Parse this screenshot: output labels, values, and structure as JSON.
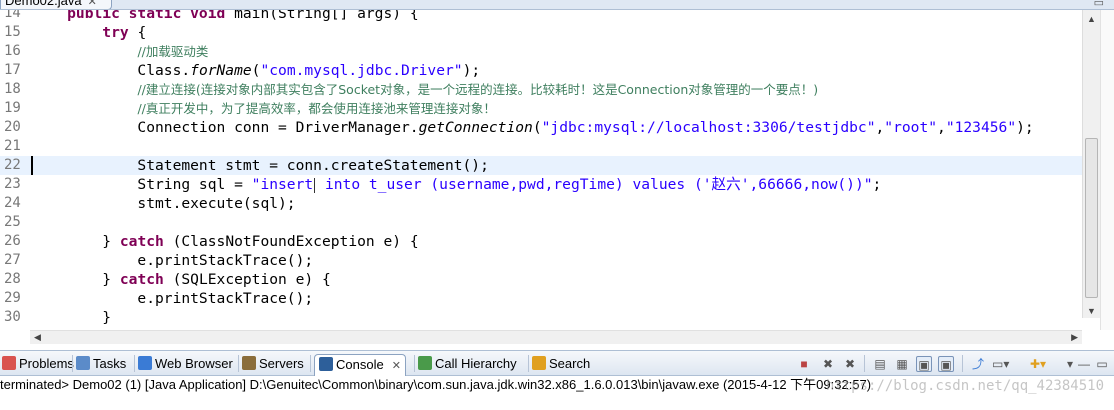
{
  "editor_tab": {
    "title": "Demo02.java",
    "close": "✕"
  },
  "code_lines": [
    {
      "num": "14",
      "segments": [
        {
          "t": "    public static void ",
          "c": "kw"
        },
        {
          "t": "main(String[] args) {",
          "c": ""
        }
      ]
    },
    {
      "num": "15",
      "segments": [
        {
          "t": "        ",
          "c": ""
        },
        {
          "t": "try",
          "c": "kw"
        },
        {
          "t": " {",
          "c": ""
        }
      ]
    },
    {
      "num": "16",
      "segments": [
        {
          "t": "            ",
          "c": ""
        },
        {
          "t": "//加载驱动类",
          "c": "cm"
        }
      ]
    },
    {
      "num": "17",
      "segments": [
        {
          "t": "            Class.",
          "c": ""
        },
        {
          "t": "forName",
          "c": "it"
        },
        {
          "t": "(",
          "c": ""
        },
        {
          "t": "\"com.mysql.jdbc.Driver\"",
          "c": "str"
        },
        {
          "t": ");",
          "c": ""
        }
      ]
    },
    {
      "num": "18",
      "segments": [
        {
          "t": "            ",
          "c": ""
        },
        {
          "t": "//建立连接(连接对象内部其实包含了Socket对象，是一个远程的连接。比较耗时！这是Connection对象管理的一个要点！)",
          "c": "cm"
        }
      ]
    },
    {
      "num": "19",
      "segments": [
        {
          "t": "            ",
          "c": ""
        },
        {
          "t": "//真正开发中，为了提高效率，都会使用连接池来管理连接对象！",
          "c": "cm"
        }
      ]
    },
    {
      "num": "20",
      "segments": [
        {
          "t": "            Connection conn = DriverManager.",
          "c": ""
        },
        {
          "t": "getConnection",
          "c": "it"
        },
        {
          "t": "(",
          "c": ""
        },
        {
          "t": "\"jdbc:mysql://localhost:3306/testjdbc\"",
          "c": "str"
        },
        {
          "t": ",",
          "c": ""
        },
        {
          "t": "\"root\"",
          "c": "str"
        },
        {
          "t": ",",
          "c": ""
        },
        {
          "t": "\"123456\"",
          "c": "str"
        },
        {
          "t": ");",
          "c": ""
        }
      ]
    },
    {
      "num": "21",
      "segments": []
    },
    {
      "num": "22",
      "segments": [
        {
          "t": "            Statement stmt = conn.createStatement();",
          "c": ""
        }
      ]
    },
    {
      "num": "23",
      "segments": [
        {
          "t": "            String sql = ",
          "c": ""
        },
        {
          "t": "\"insert",
          "c": "str"
        },
        {
          "t": "",
          "c": "cursor"
        },
        {
          "t": " into t_user (username,pwd,regTime) values ('赵六',66666,now())\"",
          "c": "str"
        },
        {
          "t": ";",
          "c": ""
        }
      ]
    },
    {
      "num": "24",
      "segments": [
        {
          "t": "            stmt.execute(sql);",
          "c": ""
        }
      ]
    },
    {
      "num": "25",
      "segments": []
    },
    {
      "num": "26",
      "segments": [
        {
          "t": "        } ",
          "c": ""
        },
        {
          "t": "catch",
          "c": "kw"
        },
        {
          "t": " (ClassNotFoundException e) {",
          "c": ""
        }
      ]
    },
    {
      "num": "27",
      "segments": [
        {
          "t": "            e.printStackTrace();",
          "c": ""
        }
      ]
    },
    {
      "num": "28",
      "segments": [
        {
          "t": "        } ",
          "c": ""
        },
        {
          "t": "catch",
          "c": "kw"
        },
        {
          "t": " (SQLException e) {",
          "c": ""
        }
      ]
    },
    {
      "num": "29",
      "segments": [
        {
          "t": "            e.printStackTrace();",
          "c": ""
        }
      ]
    },
    {
      "num": "30",
      "segments": [
        {
          "t": "        }",
          "c": ""
        }
      ]
    }
  ],
  "current_line": "22",
  "panel_tabs": [
    {
      "label": "Problems",
      "icon": "problems-icon",
      "color": "#d9534f"
    },
    {
      "label": "Tasks",
      "icon": "tasks-icon",
      "color": "#5b8bc9"
    },
    {
      "label": "Web Browser",
      "icon": "globe-icon",
      "color": "#3a7bd5"
    },
    {
      "label": "Servers",
      "icon": "servers-icon",
      "color": "#8a6d3b"
    },
    {
      "label": "Console",
      "icon": "console-icon",
      "color": "#2d5f9a",
      "active": true,
      "close": "✕"
    },
    {
      "label": "Call Hierarchy",
      "icon": "call-hierarchy-icon",
      "color": "#4a9a4a"
    },
    {
      "label": "Search",
      "icon": "search-icon",
      "color": "#e0a020"
    }
  ],
  "console_line": "terminated> Demo02 (1) [Java Application] D:\\Genuitec\\Common\\binary\\com.sun.java.jdk.win32.x86_1.6.0.013\\bin\\javaw.exe (2015-4-12 下午09:32:57)",
  "watermark": "https://blog.csdn.net/qq_42384510"
}
